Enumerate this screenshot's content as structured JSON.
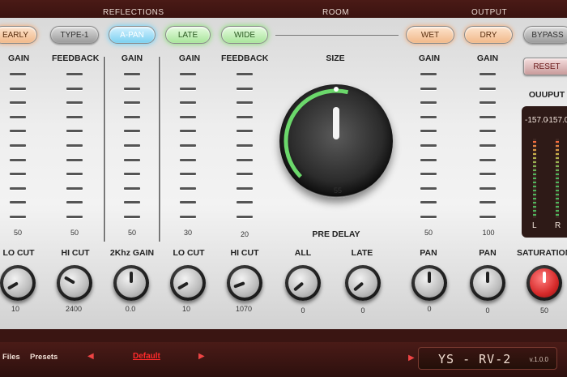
{
  "header": {
    "reflections": "REFLECTIONS",
    "room": "ROOM",
    "output": "OUTPUT"
  },
  "toggles": {
    "early": "EARLY",
    "type1": "TYPE-1",
    "apan": "A-PAN",
    "late": "LATE",
    "wide": "WIDE",
    "wet": "WET",
    "dry": "DRY",
    "bypass": "BYPASS",
    "reset": "RESET"
  },
  "faders": [
    {
      "label": "GAIN",
      "value": "50"
    },
    {
      "label": "FEEDBACK",
      "value": "50"
    },
    {
      "label": "GAIN",
      "value": "50"
    },
    {
      "label": "GAIN",
      "value": "30"
    },
    {
      "label": "FEEDBACK",
      "value": "20"
    },
    {
      "label": "GAIN",
      "value": "50"
    },
    {
      "label": "GAIN",
      "value": "100"
    }
  ],
  "size": {
    "label": "SIZE",
    "value": "55",
    "level": 0.55
  },
  "pre_delay": "PRE DELAY",
  "knobs": [
    {
      "label": "LO CUT",
      "value": "10"
    },
    {
      "label": "HI CUT",
      "value": "2400"
    },
    {
      "label": "2Khz GAIN",
      "value": "0.0"
    },
    {
      "label": "LO CUT",
      "value": "10"
    },
    {
      "label": "HI CUT",
      "value": "1070"
    },
    {
      "label": "ALL",
      "value": "0"
    },
    {
      "label": "LATE",
      "value": "0"
    },
    {
      "label": "PAN",
      "value": "0"
    },
    {
      "label": "PAN",
      "value": "0"
    },
    {
      "label": "SATURATION",
      "value": "50"
    }
  ],
  "meter": {
    "title": "OUUPUT",
    "left_value": "-157.0",
    "right_value": "-157.0",
    "left_label": "L",
    "right_label": "R"
  },
  "footer": {
    "files": "Files",
    "presets": "Presets",
    "preset_name": "Default",
    "brand": "YS - RV-2",
    "version": "v.1.0.0"
  }
}
